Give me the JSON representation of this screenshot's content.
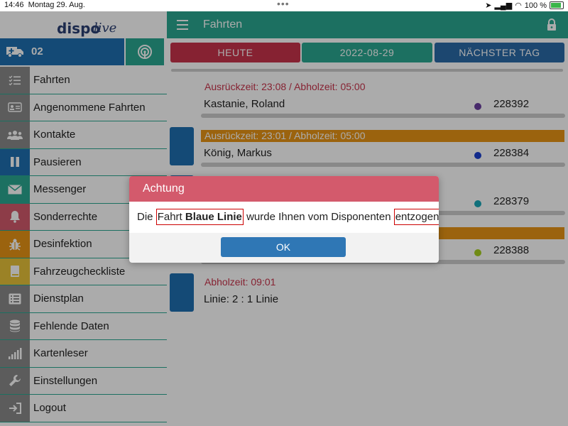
{
  "statusbar": {
    "time": "14:46",
    "date": "Montag 29. Aug.",
    "battery": "100 %",
    "dots": "•••"
  },
  "sidebar": {
    "logo_part1": "dispo",
    "logo_part2": "live",
    "vehicle_number": "02",
    "items": [
      {
        "label": "Fahrten",
        "icon": "list-check-icon",
        "color": "#8a8a8a"
      },
      {
        "label": "Angenommene Fahrten",
        "icon": "id-card-icon",
        "color": "#8a8a8a"
      },
      {
        "label": "Kontakte",
        "icon": "users-icon",
        "color": "#8a8a8a"
      },
      {
        "label": "Pausieren",
        "icon": "pause-icon",
        "color": "#1f6fb0"
      },
      {
        "label": "Messenger",
        "icon": "envelope-icon",
        "color": "#2aa891"
      },
      {
        "label": "Sonderrechte",
        "icon": "bell-icon",
        "color": "#d35a6c"
      },
      {
        "label": "Desinfektion",
        "icon": "bug-icon",
        "color": "#e89415"
      },
      {
        "label": "Fahrzeugcheckliste",
        "icon": "book-icon",
        "color": "#e8c23a"
      },
      {
        "label": "Dienstplan",
        "icon": "list-icon",
        "color": "#8a8a8a"
      },
      {
        "label": "Fehlende Daten",
        "icon": "database-icon",
        "color": "#8a8a8a"
      },
      {
        "label": "Kartenleser",
        "icon": "signal-icon",
        "color": "#8a8a8a"
      },
      {
        "label": "Einstellungen",
        "icon": "wrench-icon",
        "color": "#8a8a8a"
      },
      {
        "label": "Logout",
        "icon": "logout-icon",
        "color": "#8a8a8a"
      }
    ]
  },
  "header": {
    "title": "Fahrten"
  },
  "day_tabs": {
    "today": "HEUTE",
    "date": "2022-08-29",
    "next": "NÄCHSTER TAG"
  },
  "rides": [
    {
      "time": "Ausrückzeit: 23:08 / Abholzeit: 05:00",
      "name": "Kastanie, Roland",
      "id": "228392",
      "dot_color": "#6a3fa0",
      "highlight": false,
      "strip": false
    },
    {
      "time": "Ausrückzeit: 23:01 / Abholzeit: 05:00",
      "name": "König, Markus",
      "id": "228384",
      "dot_color": "#1a3fd0",
      "highlight": true,
      "strip": true
    },
    {
      "time": "",
      "name": "",
      "id": "228379",
      "dot_color": "#18a8b8",
      "highlight": false,
      "strip": true
    },
    {
      "time": "",
      "name": "",
      "id": "228388",
      "dot_color": "#a8d020",
      "highlight": true,
      "strip": true
    },
    {
      "time": "Abholzeit: 09:01",
      "name": "Linie: 2 : 1 Linie",
      "id": "",
      "dot_color": "",
      "highlight": false,
      "strip": true
    }
  ],
  "dialog": {
    "title": "Achtung",
    "msg_pre": "Die ",
    "msg_fahrt": "Fahrt ",
    "msg_linie": "Blaue Linie",
    "msg_mid": " wurde Ihnen vom Disponenten ",
    "msg_entzogen": "entzogen!",
    "ok_label": "OK"
  },
  "colors": {
    "teal": "#2aa891",
    "blue": "#1f6fb0",
    "red": "#d35a6c",
    "orange": "#e89415"
  }
}
